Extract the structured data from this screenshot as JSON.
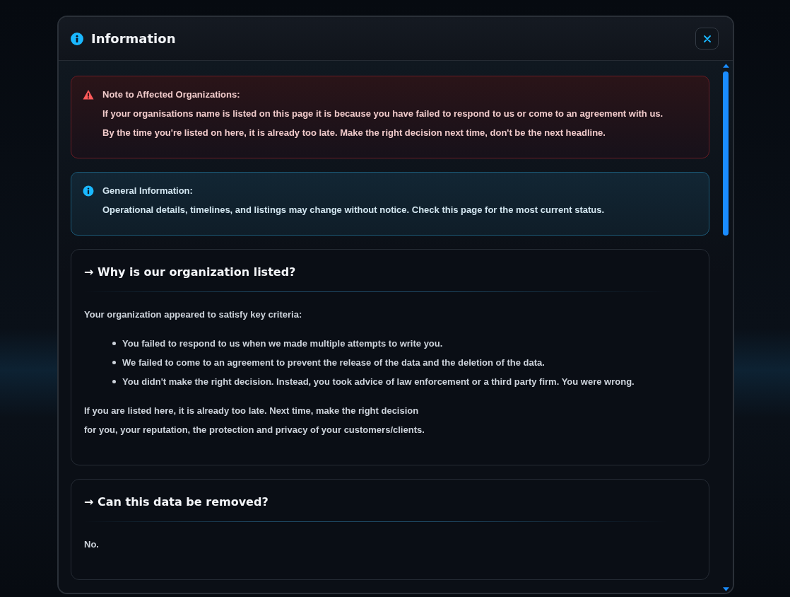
{
  "window": {
    "title": "Information"
  },
  "notes": [
    {
      "kind": "warning",
      "color": "#ff5a5a",
      "title": "Note to Affected Organizations:",
      "lines": [
        "If your organisations name is listed on this page it is because you have failed to respond to us or come to an agreement with us.",
        "By the time you're listed on here, it is already too late. Make the right decision next time, don't be the next headline."
      ]
    },
    {
      "kind": "info",
      "color": "#1ab8ff",
      "title": "General Information:",
      "lines": [
        "Operational details, timelines, and listings may change without notice. Check this page for the most current status."
      ]
    }
  ],
  "sections": [
    {
      "heading": "→ Why is our organization listed?",
      "blocks": [
        {
          "kind": "paragraph",
          "lines": [
            "Your organization appeared to satisfy key criteria:"
          ]
        },
        {
          "kind": "bullets",
          "lines": [
            "You failed to respond to us when we made multiple attempts to write you.",
            "We failed to come to an agreement to prevent the release of the data and the deletion of the data.",
            "You didn't make the right decision. Instead, you took advice of law enforcement or a third party firm. You were wrong."
          ]
        },
        {
          "kind": "paragraph",
          "lines": [
            "If you are listed here, it is already too late. Next time, make the right decision",
            "for you, your reputation, the protection and privacy of your customers/clients."
          ]
        }
      ]
    },
    {
      "heading": "→ Can this data be removed?",
      "blocks": [
        {
          "kind": "paragraph",
          "lines": [
            "No."
          ]
        }
      ]
    }
  ]
}
